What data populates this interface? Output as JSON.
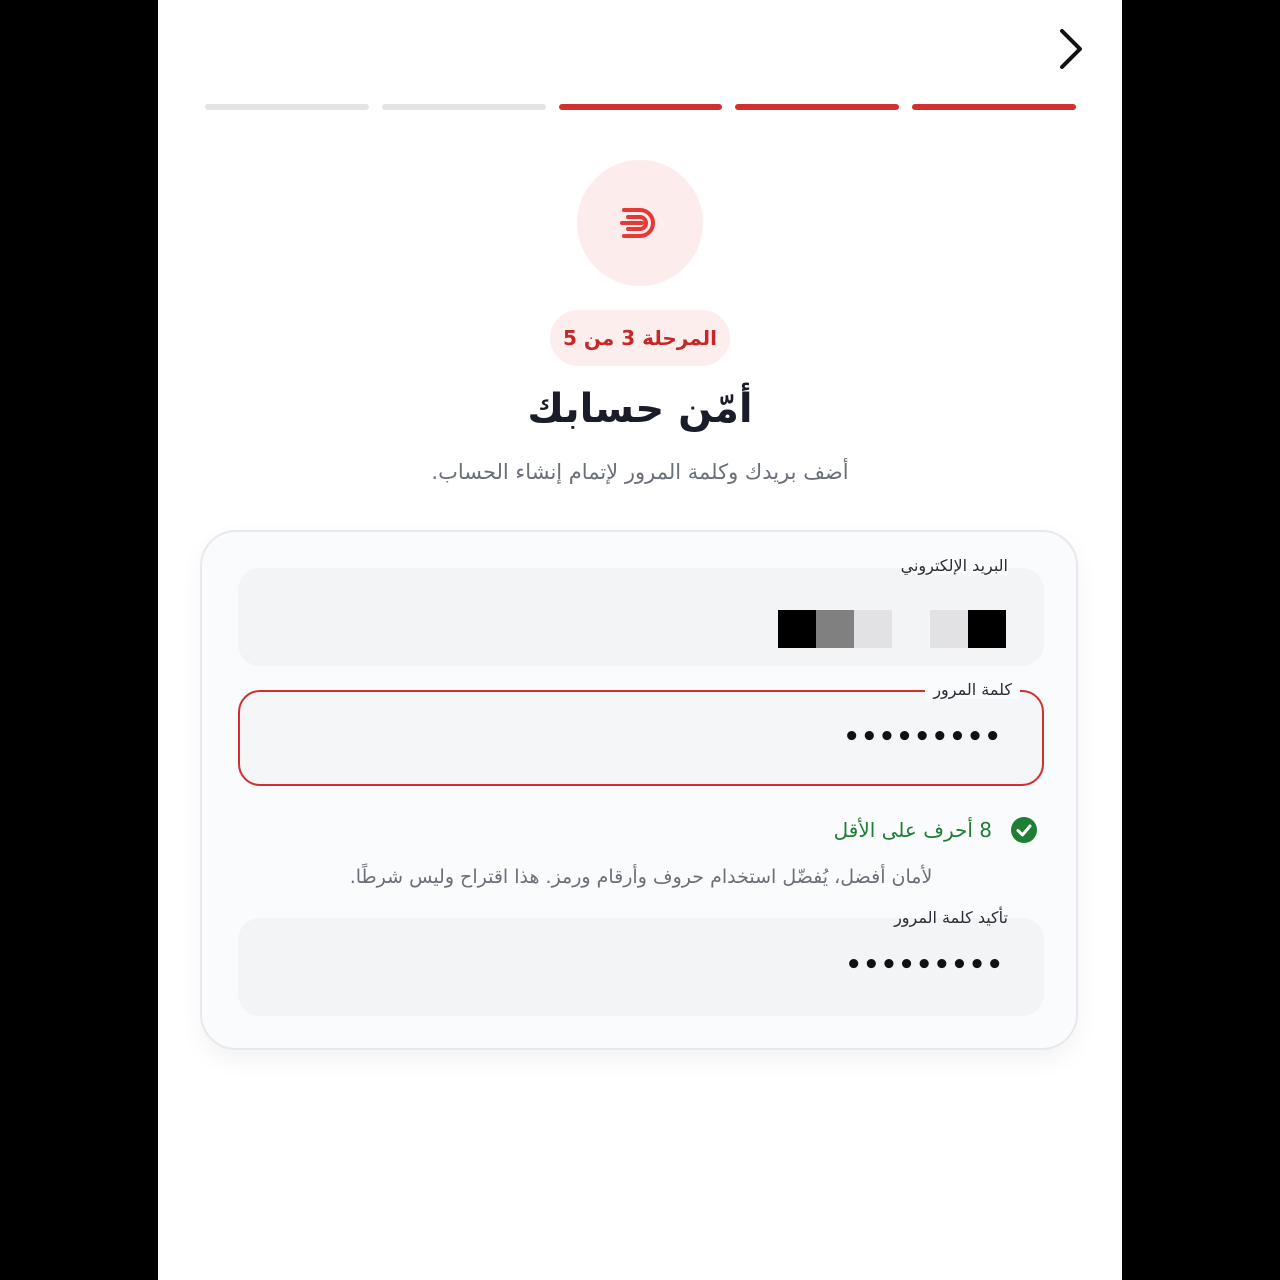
{
  "progress": {
    "total_steps": 5,
    "completed_steps": 3
  },
  "step_badge": "المرحلة 3 من 5",
  "title": "أمّن حسابك",
  "subtitle": "أضف بريدك وكلمة المرور لإتمام إنشاء الحساب.",
  "form": {
    "email": {
      "label": "البريد الإلكتروني"
    },
    "password": {
      "label": "كلمة المرور",
      "value_masked": "•••••••••"
    },
    "rule": {
      "text": "8 أحرف على الأقل",
      "icon": "check-circle-icon",
      "satisfied": true
    },
    "hint": "لأمان أفضل، يُفضّل استخدام حروف وأرقام ورمز. هذا اقتراح وليس شرطًا.",
    "confirm": {
      "label": "تأكيد كلمة المرور",
      "value_masked": "•••••••••"
    }
  },
  "icons": {
    "back": "chevron-right-icon",
    "logo": "brand-logo-icon"
  },
  "colors": {
    "accent": "#d32f2f",
    "success": "#1e7e34",
    "track": "#e4e4e7"
  }
}
